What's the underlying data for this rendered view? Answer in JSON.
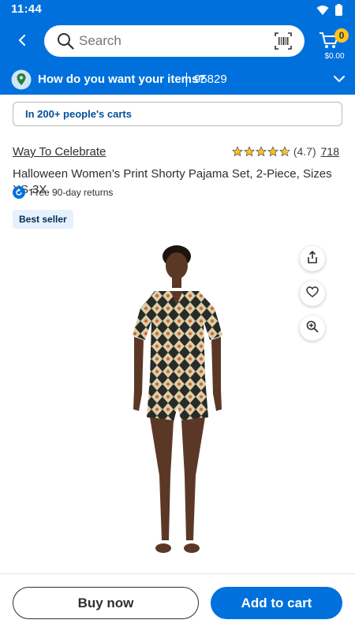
{
  "status_bar": {
    "time": "11:44",
    "icons": [
      "wifi-icon",
      "battery-icon"
    ]
  },
  "header": {
    "back_icon": "back-arrow-icon",
    "search_placeholder": "Search",
    "search_icon": "search-icon",
    "barcode_icon": "barcode-scan-icon",
    "cart_icon": "cart-icon",
    "cart_count": "0",
    "cart_total": "$0.00"
  },
  "fulfillment": {
    "question": "How do you want your items?",
    "zip": "95829",
    "icon": "location-pin-icon"
  },
  "social_proof": {
    "text": "In 200+ people's carts"
  },
  "product": {
    "brand": "Way To Celebrate",
    "rating": 4.7,
    "rating_text": "(4.7)",
    "review_count": "718",
    "title": "Halloween Women’s Print Shorty Pajama Set, 2-Piece, Sizes XS-3X",
    "returns": "Free 90-day returns",
    "badge": "Best seller"
  },
  "image_actions": [
    "share-icon",
    "heart-icon",
    "zoom-in-icon"
  ],
  "actions": {
    "buy_now": "Buy now",
    "add_to_cart": "Add to cart"
  },
  "colors": {
    "brand_blue": "#0071dc",
    "spark_yellow": "#ffc220",
    "star_color": "#ffc220",
    "badge_bg": "#e6f1fc",
    "text_dark": "#2e2f32"
  }
}
